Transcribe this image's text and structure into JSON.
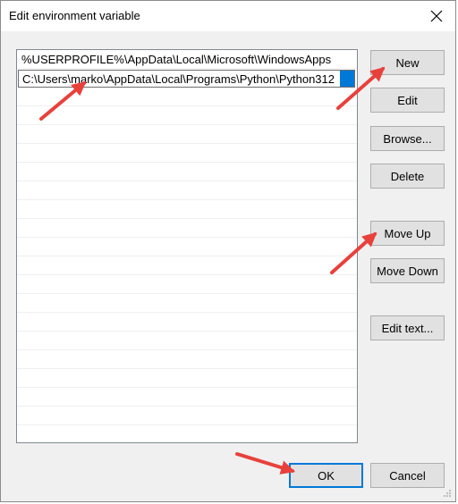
{
  "window": {
    "title": "Edit environment variable"
  },
  "list": {
    "items": [
      "%USERPROFILE%\\AppData\\Local\\Microsoft\\WindowsApps",
      "C:\\Users\\marko\\AppData\\Local\\Programs\\Python\\Python312"
    ],
    "editing_index": 1
  },
  "buttons": {
    "new": "New",
    "edit": "Edit",
    "browse": "Browse...",
    "delete": "Delete",
    "move_up": "Move Up",
    "move_down": "Move Down",
    "edit_text": "Edit text...",
    "ok": "OK",
    "cancel": "Cancel"
  },
  "colors": {
    "accent": "#0078d7",
    "annotation_arrow": "#e8413c"
  },
  "icons": {
    "close": "close-icon",
    "resize": "resize-grip-icon"
  }
}
